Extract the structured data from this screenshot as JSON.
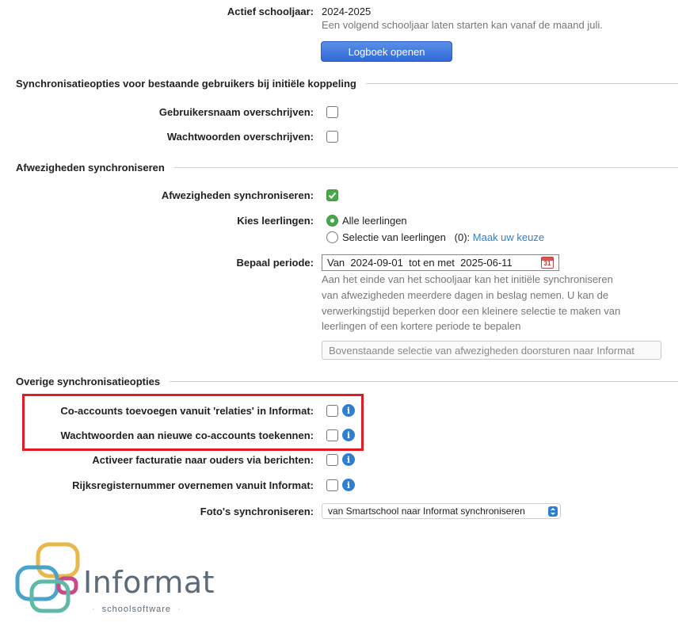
{
  "school_year": {
    "label": "Actief schooljaar:",
    "value": "2024-2025",
    "hint": "Een volgend schooljaar laten starten kan vanaf de maand juli.",
    "logbook_button": "Logboek openen"
  },
  "sync_existing": {
    "title": "Synchronisatieopties voor bestaande gebruikers bij initiële koppeling",
    "overwrite_username_label": "Gebruikersnaam overschrijven:",
    "overwrite_username_checked": false,
    "overwrite_passwords_label": "Wachtwoorden overschrijven:",
    "overwrite_passwords_checked": false
  },
  "absences": {
    "title": "Afwezigheden synchroniseren",
    "sync_label": "Afwezigheden synchroniseren:",
    "sync_checked": true,
    "students_label": "Kies leerlingen:",
    "option_all": "Alle leerlingen",
    "option_selection": "Selectie van leerlingen",
    "selection_count": "(0):",
    "selection_link": "Maak uw keuze",
    "period_label": "Bepaal periode:",
    "period_value": "Van  2024-09-01  tot en met  2025-06-11",
    "calendar_day": "31",
    "period_hint_1": "Aan het einde van het schooljaar kan het initiële synchroniseren",
    "period_hint_2": "van afwezigheden meerdere dagen in beslag nemen. U kan de",
    "period_hint_3": "verwerkingstijd beperken door een kleinere selectie te maken van",
    "period_hint_4": "leerlingen of een kortere periode te bepalen",
    "send_button": "Bovenstaande selectie van afwezigheden doorsturen naar Informat"
  },
  "other": {
    "title": "Overige synchronisatieopties",
    "coaccounts_label": "Co-accounts toevoegen vanuit 'relaties' in Informat:",
    "coaccounts_passwords_label": "Wachtwoorden aan nieuwe co-accounts toekennen:",
    "invoicing_label": "Activeer facturatie naar ouders via berichten:",
    "rijksregister_label": "Rijksregisternummer overnemen vanuit Informat:",
    "photos_label": "Foto's synchroniseren:",
    "photos_selected": "van Smartschool naar Informat synchroniseren",
    "info_glyph": "i"
  },
  "logo": {
    "name": "Informat",
    "tagline": "schoolsoftware",
    "colors": [
      "#e8b84a",
      "#4aa3c8",
      "#c84a8a",
      "#5fb8a8"
    ]
  }
}
